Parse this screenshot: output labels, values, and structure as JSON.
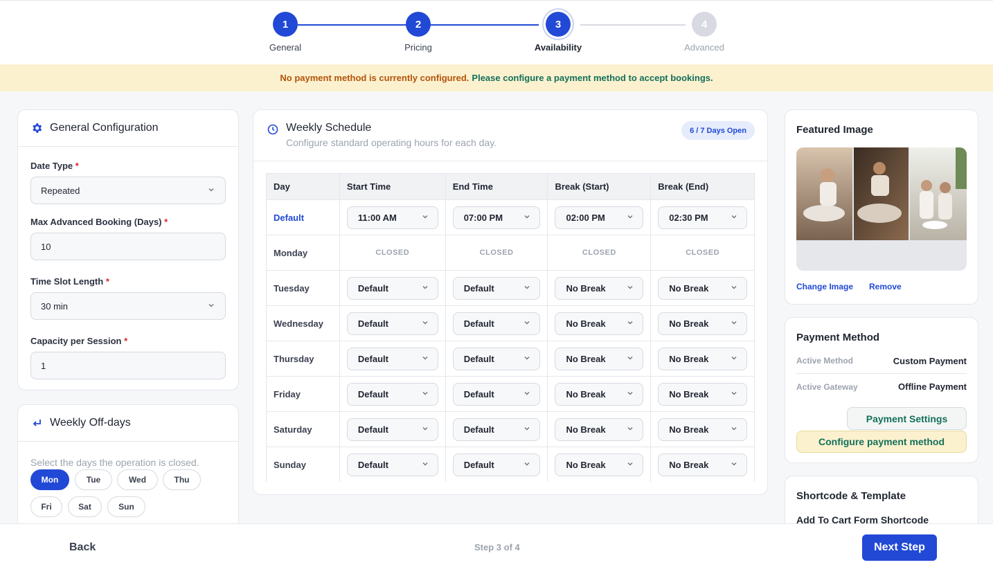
{
  "stepper": {
    "steps": [
      {
        "num": "1",
        "label": "General"
      },
      {
        "num": "2",
        "label": "Pricing"
      },
      {
        "num": "3",
        "label": "Availability"
      },
      {
        "num": "4",
        "label": "Advanced"
      }
    ]
  },
  "banner": {
    "warning": "No payment method is currently configured.",
    "hint": "Please configure a payment method to accept bookings."
  },
  "general_config": {
    "title": "General Configuration",
    "date_type_label": "Date Type",
    "date_type_value": "Repeated",
    "max_booking_label": "Max Advanced Booking (Days)",
    "max_booking_value": "10",
    "slot_length_label": "Time Slot Length",
    "slot_length_value": "30 min",
    "capacity_label": "Capacity per Session",
    "capacity_value": "1",
    "required_mark": "*"
  },
  "off_days": {
    "title": "Weekly Off-days",
    "hint": "Select the days the operation is closed.",
    "days": [
      "Mon",
      "Tue",
      "Wed",
      "Thu",
      "Fri",
      "Sat",
      "Sun"
    ]
  },
  "schedule": {
    "title": "Weekly Schedule",
    "subtitle": "Configure standard operating hours for each day.",
    "badge": "6 / 7 Days Open",
    "columns": [
      "Day",
      "Start Time",
      "End Time",
      "Break (Start)",
      "Break (End)"
    ],
    "closed_label": "CLOSED",
    "rows": [
      {
        "day": "Default",
        "start": "11:00 AM",
        "end": "07:00 PM",
        "bstart": "02:00 PM",
        "bend": "02:30 PM"
      },
      {
        "day": "Monday"
      },
      {
        "day": "Tuesday",
        "start": "Default",
        "end": "Default",
        "bstart": "No Break",
        "bend": "No Break"
      },
      {
        "day": "Wednesday",
        "start": "Default",
        "end": "Default",
        "bstart": "No Break",
        "bend": "No Break"
      },
      {
        "day": "Thursday",
        "start": "Default",
        "end": "Default",
        "bstart": "No Break",
        "bend": "No Break"
      },
      {
        "day": "Friday",
        "start": "Default",
        "end": "Default",
        "bstart": "No Break",
        "bend": "No Break"
      },
      {
        "day": "Saturday",
        "start": "Default",
        "end": "Default",
        "bstart": "No Break",
        "bend": "No Break"
      },
      {
        "day": "Sunday",
        "start": "Default",
        "end": "Default",
        "bstart": "No Break",
        "bend": "No Break"
      }
    ]
  },
  "featured_image": {
    "title": "Featured Image",
    "change_label": "Change Image",
    "remove_label": "Remove"
  },
  "payment": {
    "title": "Payment Method",
    "active_method_label": "Active Method",
    "active_method_value": "Custom Payment",
    "active_gateway_label": "Active Gateway",
    "active_gateway_value": "Offline Payment",
    "settings_label": "Payment Settings",
    "configure_label": "Configure payment method"
  },
  "shortcode": {
    "title": "Shortcode & Template",
    "subtitle": "Add To Cart Form Shortcode"
  },
  "footer": {
    "back_label": "Back",
    "step_info": "Step 3 of 4",
    "next_label": "Next Step"
  }
}
